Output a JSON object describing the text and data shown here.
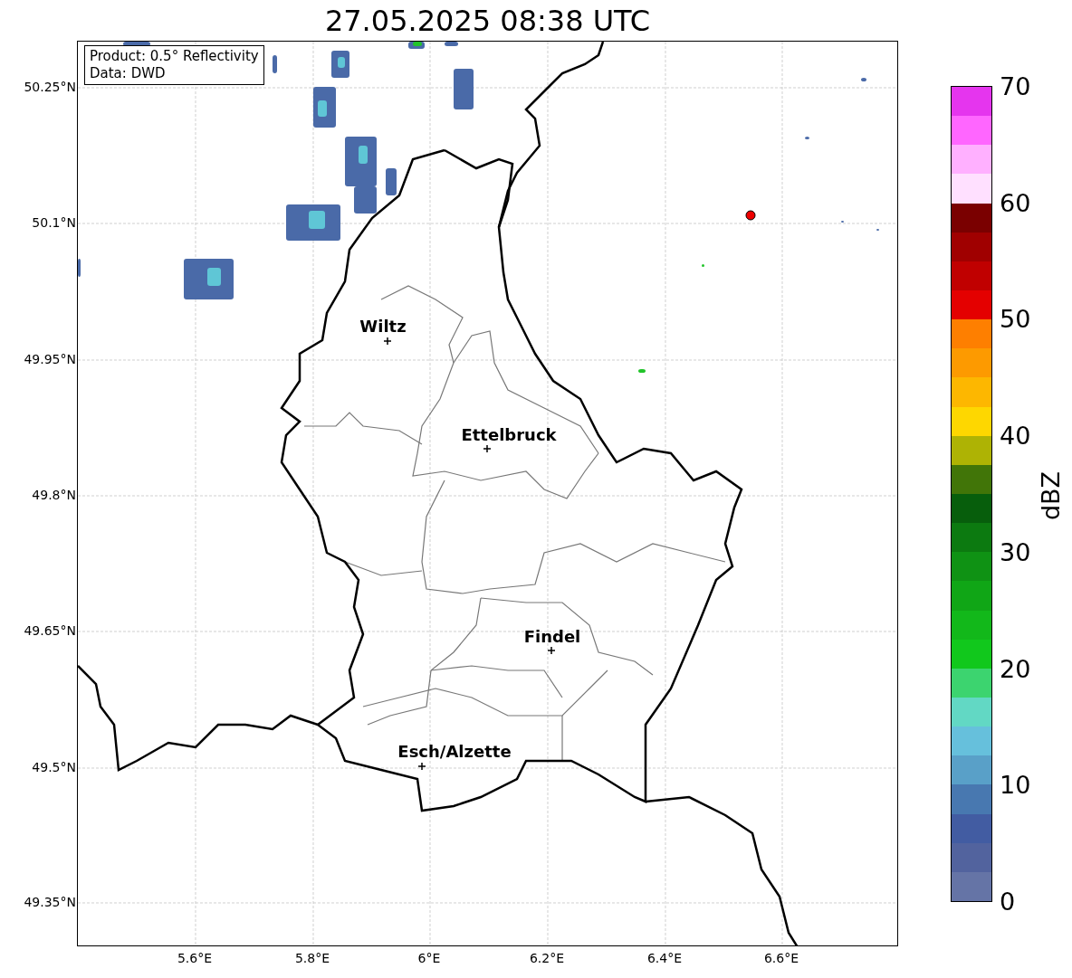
{
  "title": "27.05.2025 08:38 UTC",
  "legend": [
    "Product: 0.5° Reflectivity",
    "Data: DWD"
  ],
  "map": {
    "y_ticks": [
      "50.25°N",
      "50.1°N",
      "49.95°N",
      "49.8°N",
      "49.65°N",
      "49.5°N",
      "49.35°N"
    ],
    "x_ticks": [
      "5.6°E",
      "5.8°E",
      "6°E",
      "6.2°E",
      "6.4°E",
      "6.6°E"
    ],
    "cities": [
      "Wiltz",
      "Ettelbruck",
      "Findel",
      "Esch/Alzette"
    ]
  },
  "colorbar": {
    "label": "dBZ",
    "ticks": [
      "70",
      "60",
      "50",
      "40",
      "30",
      "20",
      "10",
      "0"
    ],
    "segments": [
      {
        "color": "#e535ee"
      },
      {
        "color": "#ff66ff"
      },
      {
        "color": "#ffb0ff"
      },
      {
        "color": "#ffe0ff"
      },
      {
        "color": "#7a0000"
      },
      {
        "color": "#a00000"
      },
      {
        "color": "#c00000"
      },
      {
        "color": "#e40000"
      },
      {
        "color": "#fe7f00"
      },
      {
        "color": "#fd9a00"
      },
      {
        "color": "#fdb700"
      },
      {
        "color": "#fed700"
      },
      {
        "color": "#aeb304"
      },
      {
        "color": "#417508"
      },
      {
        "color": "#075e0c"
      },
      {
        "color": "#0c7a10"
      },
      {
        "color": "#0f9214"
      },
      {
        "color": "#10a616"
      },
      {
        "color": "#12b81a"
      },
      {
        "color": "#11c81c"
      },
      {
        "color": "#3cd46f"
      },
      {
        "color": "#62d8c4"
      },
      {
        "color": "#66c0dc"
      },
      {
        "color": "#59a0c8"
      },
      {
        "color": "#4878b0"
      },
      {
        "color": "#425ca2"
      },
      {
        "color": "#52639e"
      },
      {
        "color": "#6574a6"
      }
    ]
  }
}
